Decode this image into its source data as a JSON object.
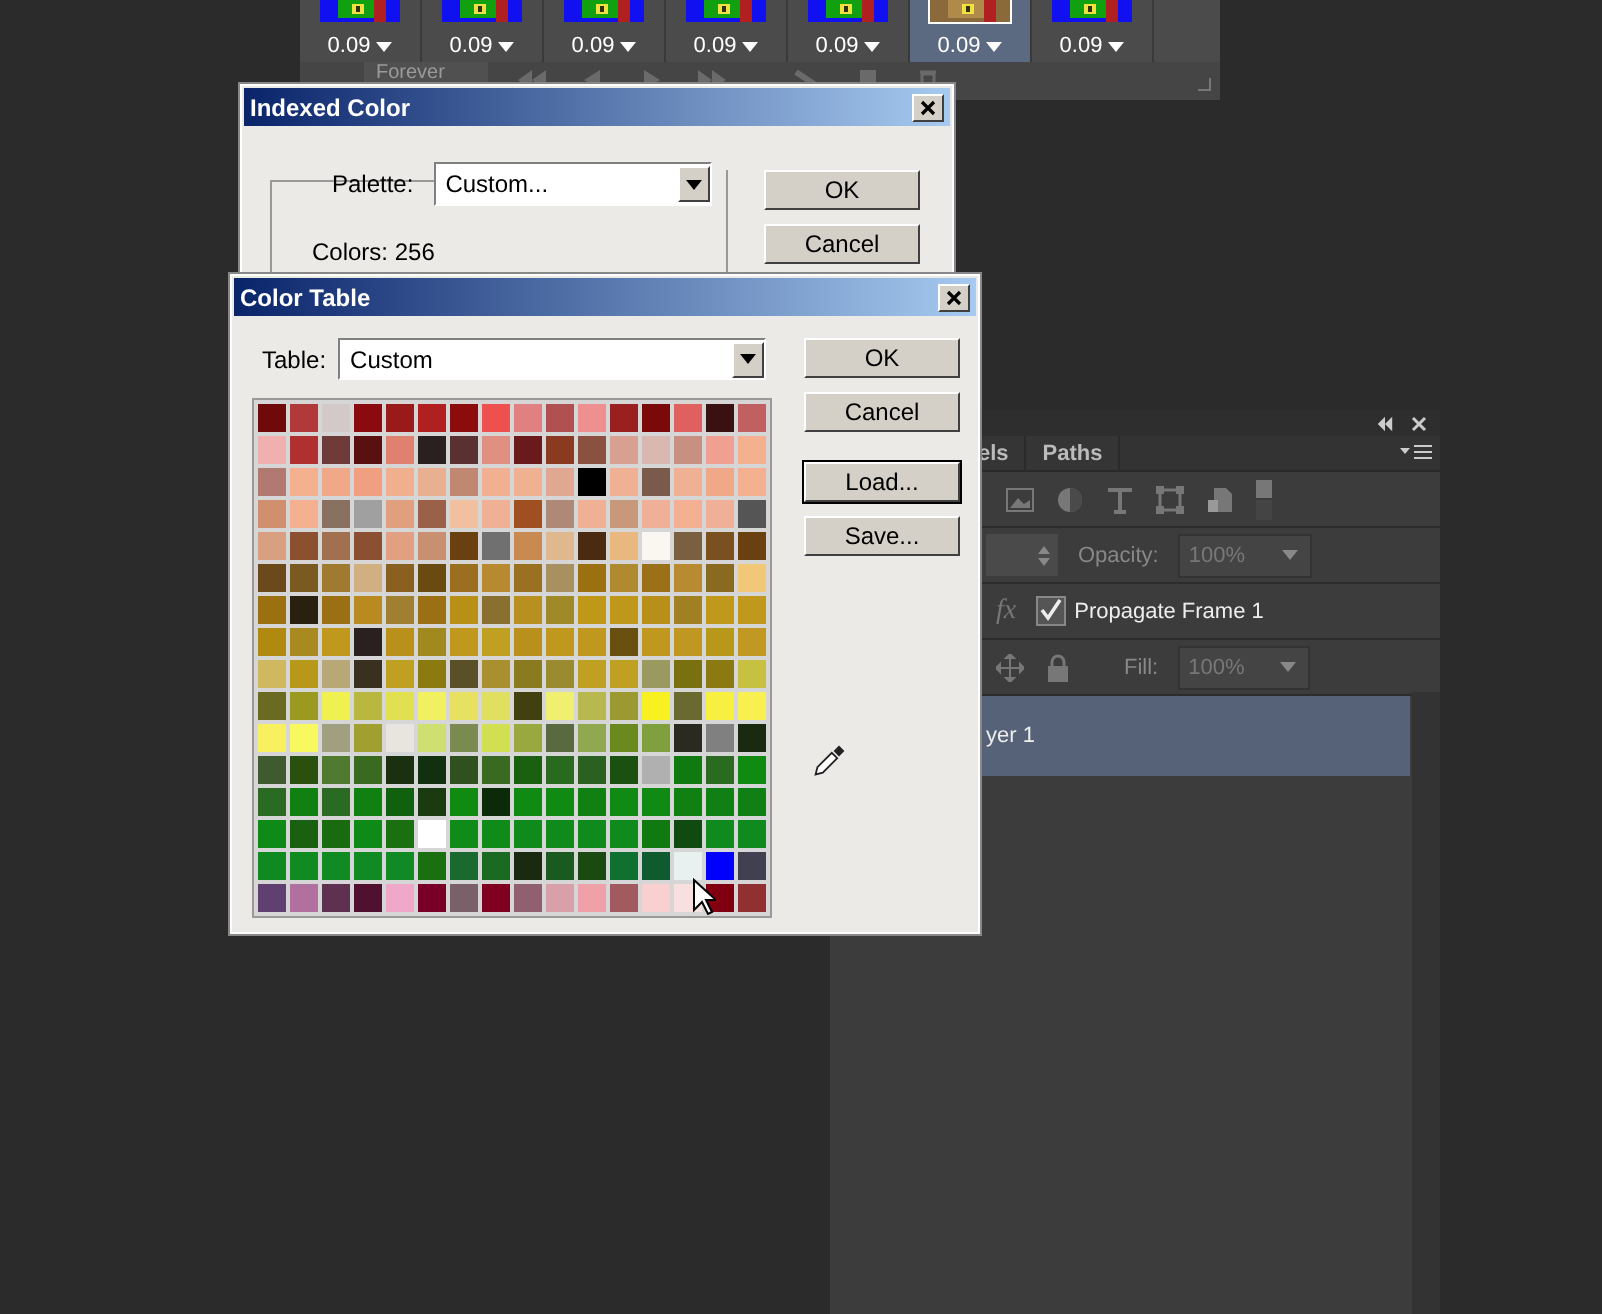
{
  "timeline": {
    "frames": [
      {
        "delay": "0.09",
        "selected": false
      },
      {
        "delay": "0.09",
        "selected": false
      },
      {
        "delay": "0.09",
        "selected": false
      },
      {
        "delay": "0.09",
        "selected": false
      },
      {
        "delay": "0.09",
        "selected": false
      },
      {
        "delay": "0.09",
        "selected": true
      },
      {
        "delay": "0.09",
        "selected": false
      }
    ],
    "loop": "Forever"
  },
  "indexed_color": {
    "title": "Indexed Color",
    "palette_label": "Palette:",
    "palette": "Custom...",
    "colors": "Colors: 256",
    "buttons": [
      "OK",
      "Cancel"
    ]
  },
  "color_table": {
    "title": "Color Table",
    "table_label": "Table:",
    "table": "Custom",
    "buttons": [
      {
        "label": "OK",
        "focused": false
      },
      {
        "label": "Cancel",
        "focused": false
      },
      {
        "label": "Load...",
        "focused": true
      },
      {
        "label": "Save...",
        "focused": false
      }
    ],
    "rows": [
      {
        "swatches": [
          {
            "color": "#6e0a0a"
          },
          {
            "color": "#b03a3a"
          },
          {
            "color": "#d3c9c9"
          },
          {
            "color": "#8a0a10"
          },
          {
            "color": "#9a1a1a"
          },
          {
            "color": "#b02020"
          },
          {
            "color": "#8c0c0c"
          },
          {
            "color": "#ee5050"
          },
          {
            "color": "#e08080"
          },
          {
            "color": "#b05050"
          },
          {
            "color": "#ee9090"
          },
          {
            "color": "#9a2020"
          },
          {
            "color": "#7a0a0a"
          },
          {
            "color": "#e06060"
          },
          {
            "color": "#3a1010"
          },
          {
            "color": "#c06060"
          }
        ]
      },
      {
        "swatches": [
          {
            "color": "#f0b0b0"
          },
          {
            "color": "#b03030"
          },
          {
            "color": "#6e3a3a"
          },
          {
            "color": "#5a1010"
          },
          {
            "color": "#e08070"
          },
          {
            "color": "#2a2020"
          },
          {
            "color": "#5a3030"
          },
          {
            "color": "#e09080"
          },
          {
            "color": "#6a1a1a"
          },
          {
            "color": "#8a3a20"
          },
          {
            "color": "#8a5040"
          },
          {
            "color": "#d8a090"
          },
          {
            "color": "#d8b8b0"
          },
          {
            "color": "#c89080"
          },
          {
            "color": "#f0a090"
          },
          {
            "color": "#f5b090"
          }
        ]
      },
      {
        "swatches": [
          {
            "color": "#b07a70"
          },
          {
            "color": "#f5b090"
          },
          {
            "color": "#f0a888"
          },
          {
            "color": "#f0a080"
          },
          {
            "color": "#f0b090"
          },
          {
            "color": "#e8b090"
          },
          {
            "color": "#c08870"
          },
          {
            "color": "#f0b091"
          },
          {
            "color": "#f0b092"
          },
          {
            "color": "#e0a890"
          },
          {
            "color": "#000000"
          },
          {
            "color": "#f0b093"
          },
          {
            "color": "#7a5a4a"
          },
          {
            "color": "#f0b094"
          },
          {
            "color": "#f0a889"
          },
          {
            "color": "#f5b091"
          }
        ]
      },
      {
        "swatches": [
          {
            "color": "#d09070"
          },
          {
            "color": "#f5b092"
          },
          {
            "color": "#8a7060"
          },
          {
            "color": "#a0a0a0"
          },
          {
            "color": "#e0a080"
          },
          {
            "color": "#9a6048"
          },
          {
            "color": "#f0c0a0"
          },
          {
            "color": "#f0b095"
          },
          {
            "color": "#a05020"
          },
          {
            "color": "#b08878"
          },
          {
            "color": "#f0b096"
          },
          {
            "color": "#c8987a"
          },
          {
            "color": "#f0b097"
          },
          {
            "color": "#f5b093"
          },
          {
            "color": "#f0b098"
          },
          {
            "color": "#555555"
          }
        ]
      },
      {
        "swatches": [
          {
            "color": "#d8a080"
          },
          {
            "color": "#8a5030"
          },
          {
            "color": "#a07050"
          },
          {
            "color": "#8a5031"
          },
          {
            "color": "#e0a081"
          },
          {
            "color": "#c89070"
          },
          {
            "color": "#6a4010"
          },
          {
            "color": "#707070"
          },
          {
            "color": "#c88a50"
          },
          {
            "color": "#e0b890"
          },
          {
            "color": "#4a2a10"
          },
          {
            "color": "#e8b880"
          },
          {
            "color": "#faf6f2"
          },
          {
            "color": "#7a6040"
          },
          {
            "color": "#7a5020"
          },
          {
            "color": "#6a4011"
          }
        ]
      },
      {
        "swatches": [
          {
            "color": "#6a4a1a"
          },
          {
            "color": "#7a5a20"
          },
          {
            "color": "#a07a30"
          },
          {
            "color": "#d0b080"
          },
          {
            "color": "#8a6020"
          },
          {
            "color": "#6a4a10"
          },
          {
            "color": "#9a7020"
          },
          {
            "color": "#b88a30"
          },
          {
            "color": "#9a7021"
          },
          {
            "color": "#a89060"
          },
          {
            "color": "#9a7010"
          },
          {
            "color": "#b08a30"
          },
          {
            "color": "#9a7018"
          },
          {
            "color": "#b88a31"
          },
          {
            "color": "#8a6a20"
          },
          {
            "color": "#f0c878"
          }
        ]
      },
      {
        "swatches": [
          {
            "color": "#9a7011"
          },
          {
            "color": "#2a2010"
          },
          {
            "color": "#9a7012"
          },
          {
            "color": "#b88a20"
          },
          {
            "color": "#a08030"
          },
          {
            "color": "#9a7013"
          },
          {
            "color": "#b89018"
          },
          {
            "color": "#8a7030"
          },
          {
            "color": "#b89020"
          },
          {
            "color": "#a08a28"
          },
          {
            "color": "#c09818"
          },
          {
            "color": "#c09819"
          },
          {
            "color": "#b89019"
          },
          {
            "color": "#a08020"
          },
          {
            "color": "#c0981a"
          },
          {
            "color": "#c0981b"
          }
        ]
      },
      {
        "swatches": [
          {
            "color": "#b08a10"
          },
          {
            "color": "#a88a20"
          },
          {
            "color": "#c0981c"
          },
          {
            "color": "#2a2020"
          },
          {
            "color": "#b8901a"
          },
          {
            "color": "#a08a20"
          },
          {
            "color": "#c0981d"
          },
          {
            "color": "#c0a020"
          },
          {
            "color": "#b8901b"
          },
          {
            "color": "#c0981e"
          },
          {
            "color": "#c0981f"
          },
          {
            "color": "#6a5010"
          },
          {
            "color": "#c09820"
          },
          {
            "color": "#c09821"
          },
          {
            "color": "#b89818"
          },
          {
            "color": "#c09822"
          }
        ]
      },
      {
        "swatches": [
          {
            "color": "#d0b860"
          },
          {
            "color": "#b89819"
          },
          {
            "color": "#b8a878"
          },
          {
            "color": "#3a3020"
          },
          {
            "color": "#c0a021"
          },
          {
            "color": "#8a7a10"
          },
          {
            "color": "#5a5028"
          },
          {
            "color": "#a89030"
          },
          {
            "color": "#8a7a20"
          },
          {
            "color": "#9a8a30"
          },
          {
            "color": "#c0a022"
          },
          {
            "color": "#c0a023"
          },
          {
            "color": "#9a9a60"
          },
          {
            "color": "#7a7010"
          },
          {
            "color": "#8a7a11"
          },
          {
            "color": "#c8c040"
          }
        ]
      },
      {
        "swatches": [
          {
            "color": "#6a6a20"
          },
          {
            "color": "#9a9a20"
          },
          {
            "color": "#f0f050"
          },
          {
            "color": "#b8b840"
          },
          {
            "color": "#e0e050"
          },
          {
            "color": "#f0f060"
          },
          {
            "color": "#e8e060"
          },
          {
            "color": "#e0e060"
          },
          {
            "color": "#404010"
          },
          {
            "color": "#f0f070"
          },
          {
            "color": "#b8b850"
          },
          {
            "color": "#9a9a30"
          },
          {
            "color": "#f8f020"
          },
          {
            "color": "#6a6a30"
          },
          {
            "color": "#f8f040"
          },
          {
            "color": "#f8f050"
          }
        ]
      },
      {
        "swatches": [
          {
            "color": "#f8f060"
          },
          {
            "color": "#f8f860"
          },
          {
            "color": "#a0a080"
          },
          {
            "color": "#a0a030"
          },
          {
            "color": "#e8e4e0"
          },
          {
            "color": "#d0e070"
          },
          {
            "color": "#7a8a50"
          },
          {
            "color": "#d0e050"
          },
          {
            "color": "#9aa840"
          },
          {
            "color": "#5a6a40"
          },
          {
            "color": "#90a850"
          },
          {
            "color": "#6a8a20"
          },
          {
            "color": "#80a040"
          },
          {
            "color": "#2a2a20"
          },
          {
            "color": "#808080"
          },
          {
            "color": "#1a2a10"
          }
        ]
      },
      {
        "swatches": [
          {
            "color": "#405a30"
          },
          {
            "color": "#2a5010"
          },
          {
            "color": "#507a30"
          },
          {
            "color": "#3a6a20"
          },
          {
            "color": "#1a3010"
          },
          {
            "color": "#103010"
          },
          {
            "color": "#305020"
          },
          {
            "color": "#3a6a21"
          },
          {
            "color": "#1a6010"
          },
          {
            "color": "#2a6a20"
          },
          {
            "color": "#2a6020"
          },
          {
            "color": "#1a5010"
          },
          {
            "color": "#b0b0b0"
          },
          {
            "color": "#107a10"
          },
          {
            "color": "#2a6a21"
          },
          {
            "color": "#108a10"
          }
        ]
      },
      {
        "swatches": [
          {
            "color": "#2a6a22"
          },
          {
            "color": "#108010"
          },
          {
            "color": "#2a6a23"
          },
          {
            "color": "#108011"
          },
          {
            "color": "#106010"
          },
          {
            "color": "#1a3a10"
          },
          {
            "color": "#108a11"
          },
          {
            "color": "#0a2a0a"
          },
          {
            "color": "#108a12"
          },
          {
            "color": "#108a13"
          },
          {
            "color": "#108012"
          },
          {
            "color": "#108a14"
          },
          {
            "color": "#108a15"
          },
          {
            "color": "#108013"
          },
          {
            "color": "#108014"
          },
          {
            "color": "#108015"
          }
        ]
      },
      {
        "swatches": [
          {
            "color": "#108a16"
          },
          {
            "color": "#1a6011"
          },
          {
            "color": "#1a6a10"
          },
          {
            "color": "#108a17"
          },
          {
            "color": "#1a7010"
          },
          {
            "color": "#ffffff"
          },
          {
            "color": "#108a18"
          },
          {
            "color": "#108a19"
          },
          {
            "color": "#108a1a"
          },
          {
            "color": "#108a1b"
          },
          {
            "color": "#108a1c"
          },
          {
            "color": "#108a1d"
          },
          {
            "color": "#107a11"
          },
          {
            "color": "#104a10"
          },
          {
            "color": "#108a1e"
          },
          {
            "color": "#108a1f"
          }
        ]
      },
      {
        "swatches": [
          {
            "color": "#108a20"
          },
          {
            "color": "#108a21"
          },
          {
            "color": "#108a22"
          },
          {
            "color": "#108a23"
          },
          {
            "color": "#108a24"
          },
          {
            "color": "#1a7011"
          },
          {
            "color": "#1a6a30"
          },
          {
            "color": "#1a6a22"
          },
          {
            "color": "#1a2a10"
          },
          {
            "color": "#1a5a20"
          },
          {
            "color": "#1a4a10"
          },
          {
            "color": "#107030"
          },
          {
            "color": "#105a30"
          },
          {
            "color": "#e8f0f0"
          },
          {
            "color": "#0000ff"
          },
          {
            "color": "#404050"
          }
        ]
      },
      {
        "swatches": [
          {
            "color": "#604070"
          },
          {
            "color": "#b070a0"
          },
          {
            "color": "#603050"
          },
          {
            "color": "#501030"
          },
          {
            "color": "#f0a8c8"
          },
          {
            "color": "#780028"
          },
          {
            "color": "#7a6068"
          },
          {
            "color": "#800020"
          },
          {
            "color": "#906070"
          },
          {
            "color": "#d8a0a8"
          },
          {
            "color": "#f0a0a8"
          },
          {
            "color": "#a05a60"
          },
          {
            "color": "#f8d0d0"
          },
          {
            "color": "#f8e0e0"
          },
          {
            "color": "#800010"
          },
          {
            "color": "#903030"
          }
        ]
      }
    ]
  },
  "layers_panel": {
    "fx_icon": "fx",
    "tabs": [
      {
        "label": "els",
        "selected": false
      },
      {
        "label": "Paths",
        "selected": false
      }
    ],
    "opacity_label": "Opacity:",
    "opacity": "100%",
    "propagate": {
      "label": "Propagate Frame 1",
      "checked": true
    },
    "fill_label": "Fill:",
    "fill": "100%",
    "layers": [
      {
        "name": "yer 1",
        "selected": true
      }
    ]
  }
}
